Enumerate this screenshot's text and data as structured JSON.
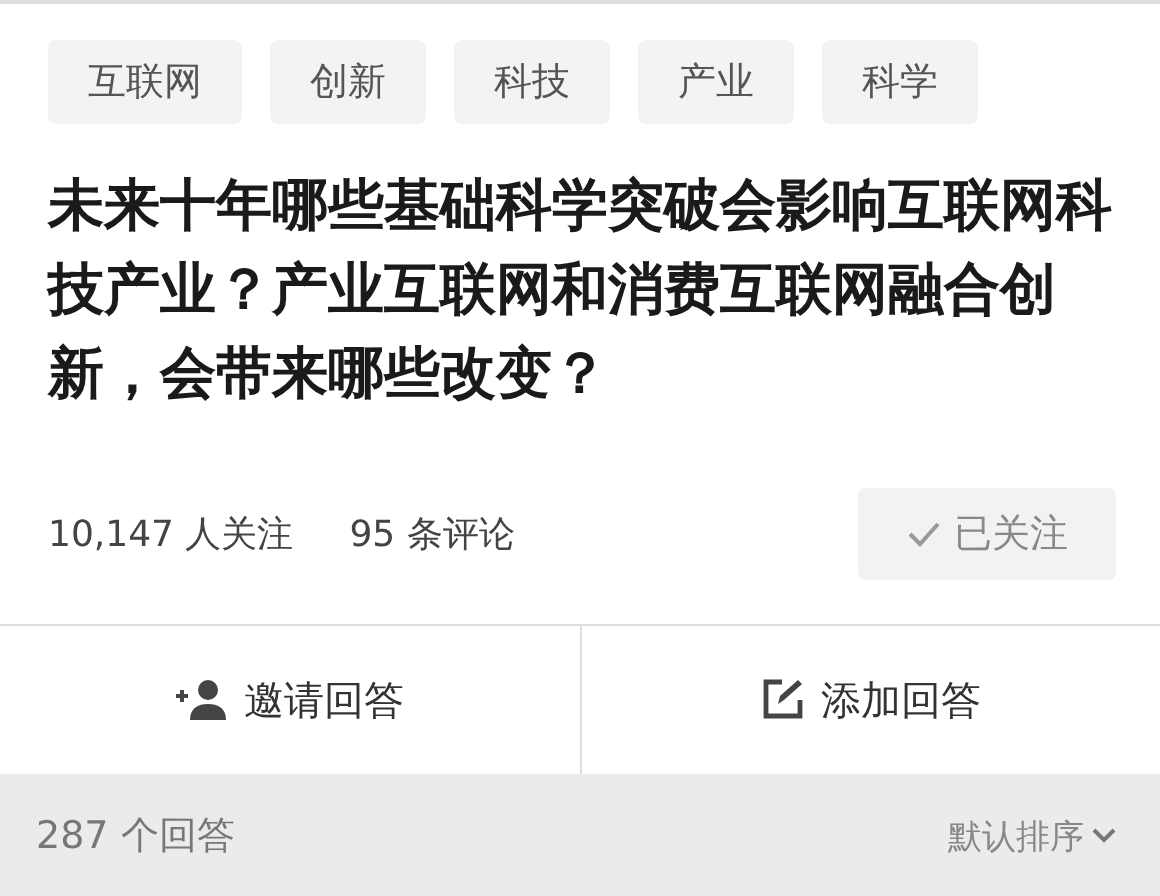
{
  "tags": [
    "互联网",
    "创新",
    "科技",
    "产业",
    "科学"
  ],
  "question": {
    "title": "未来十年哪些基础科学突破会影响互联网科技产业？产业互联网和消费互联网融合创新，会带来哪些改变？"
  },
  "stats": {
    "followers": "10,147 人关注",
    "comments": "95 条评论"
  },
  "follow_button": {
    "label": "已关注",
    "followed": true
  },
  "actions": [
    {
      "kind": "invite",
      "label": "邀请回答"
    },
    {
      "kind": "write",
      "label": "添加回答"
    }
  ],
  "answers_bar": {
    "count": "287 个回答",
    "sort": "默认排序"
  }
}
